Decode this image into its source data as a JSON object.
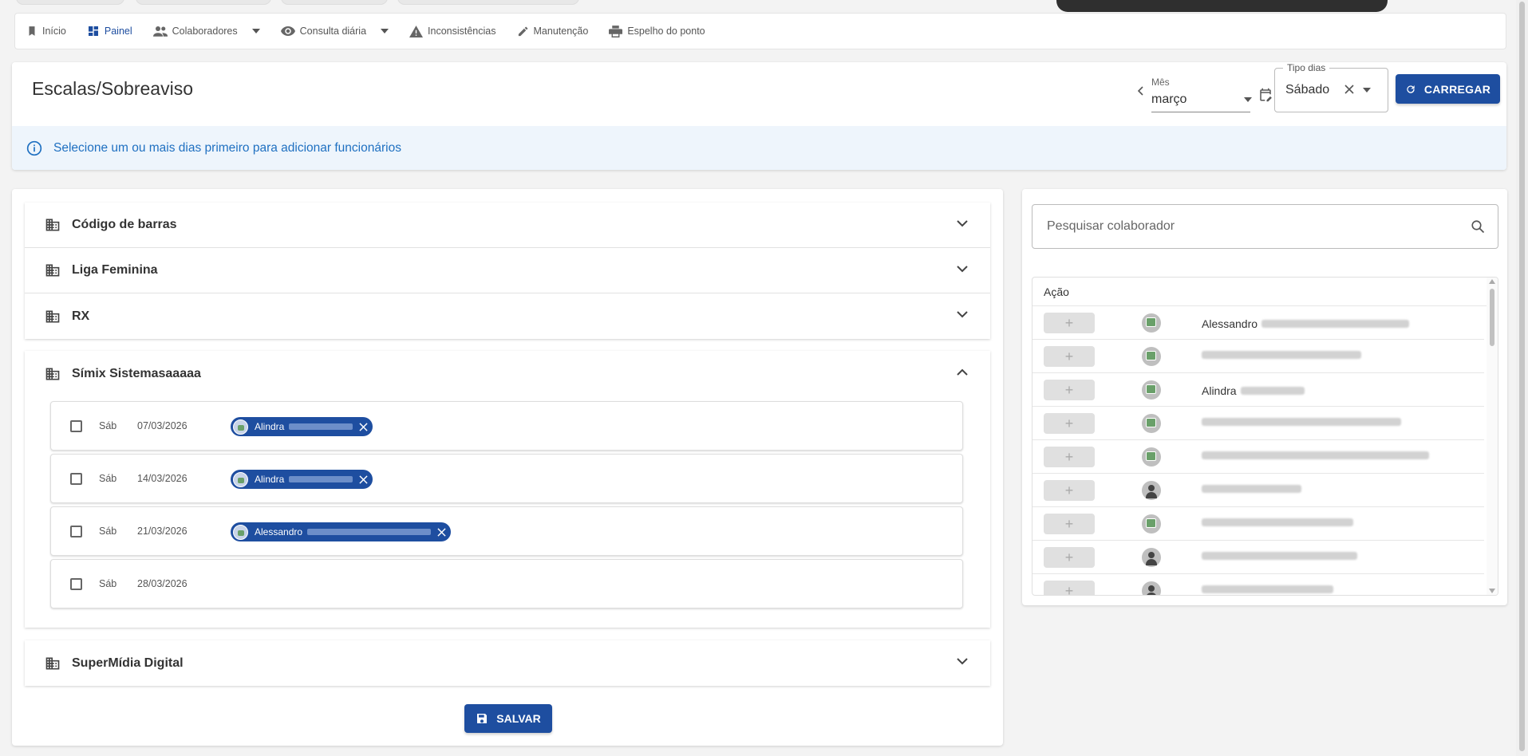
{
  "nav": {
    "items": [
      {
        "label": "Início",
        "icon": "bookmark-icon",
        "active": false
      },
      {
        "label": "Painel",
        "icon": "dashboard-icon",
        "active": true
      },
      {
        "label": "Colaboradores",
        "icon": "people-icon",
        "active": false,
        "dropdown": true
      },
      {
        "label": "Consulta diária",
        "icon": "eye-icon",
        "active": false,
        "dropdown": true
      },
      {
        "label": "Inconsistências",
        "icon": "warning-icon",
        "active": false
      },
      {
        "label": "Manutenção",
        "icon": "pencil-icon",
        "active": false
      },
      {
        "label": "Espelho do ponto",
        "icon": "printer-icon",
        "active": false
      }
    ]
  },
  "header": {
    "title": "Escalas/Sobreaviso",
    "month_label": "Mês",
    "month_value": "março",
    "tipo_label": "Tipo dias",
    "tipo_value": "Sábado",
    "carregar_label": "CARREGAR",
    "info_text": "Selecione um ou mais dias primeiro para adicionar funcionários"
  },
  "groups": {
    "g1": "Código de barras",
    "g2": "Liga Feminina",
    "g3": "RX",
    "g4": "Símix Sistemasaaaaa",
    "g5": "SuperMídia Digital"
  },
  "days": [
    {
      "weekday": "Sáb",
      "date": "07/03/2026",
      "checked": false,
      "chip": "Alindra"
    },
    {
      "weekday": "Sáb",
      "date": "14/03/2026",
      "checked": false,
      "chip": "Alindra"
    },
    {
      "weekday": "Sáb",
      "date": "21/03/2026",
      "checked": false,
      "chip": "Alessandro"
    },
    {
      "weekday": "Sáb",
      "date": "28/03/2026",
      "checked": false,
      "chip": null
    }
  ],
  "salvar_label": "SALVAR",
  "search": {
    "placeholder": "Pesquisar colaborador"
  },
  "employee_table": {
    "header": "Ação",
    "rows": [
      {
        "name": "Alessandro",
        "avatar": "image"
      },
      {
        "name": "",
        "avatar": "image"
      },
      {
        "name": "Alindra",
        "avatar": "image"
      },
      {
        "name": "",
        "avatar": "image"
      },
      {
        "name": "",
        "avatar": "image"
      },
      {
        "name": "",
        "avatar": "person"
      },
      {
        "name": "",
        "avatar": "image"
      },
      {
        "name": "",
        "avatar": "person"
      },
      {
        "name": "",
        "avatar": "person"
      }
    ]
  },
  "colors": {
    "primary": "#1e4ea0",
    "info_bg": "#eef5fc",
    "info_text": "#1f70c1"
  }
}
